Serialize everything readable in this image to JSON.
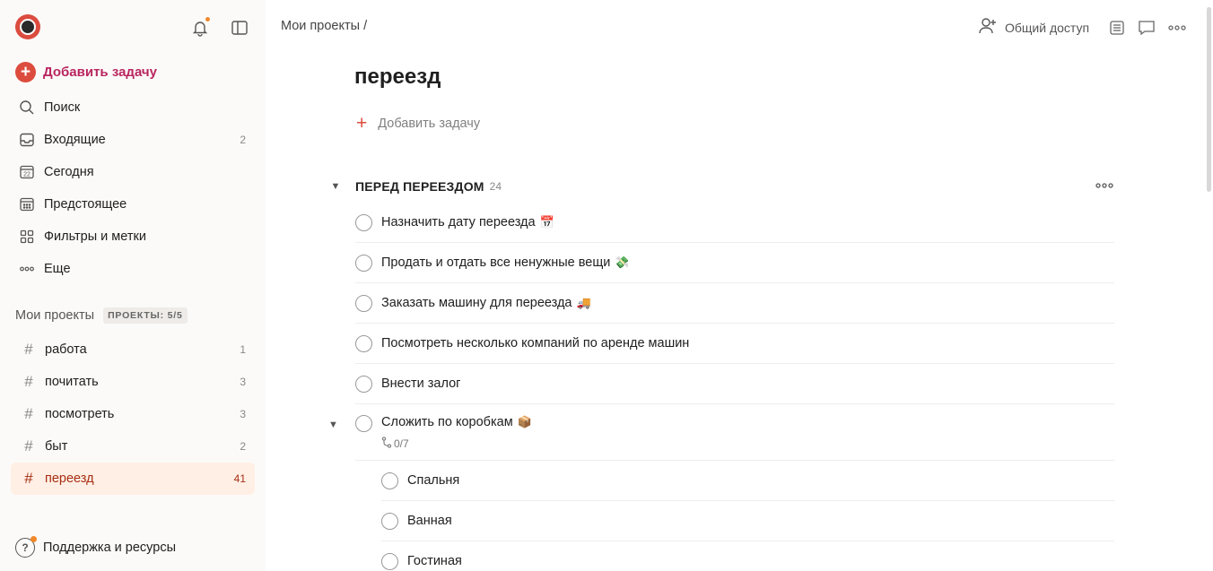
{
  "sidebar": {
    "add_task": "Добавить задачу",
    "nav": [
      {
        "label": "Поиск",
        "icon": "search-icon",
        "count": ""
      },
      {
        "label": "Входящие",
        "icon": "inbox-icon",
        "count": "2"
      },
      {
        "label": "Сегодня",
        "icon": "calendar-today-icon",
        "count": ""
      },
      {
        "label": "Предстоящее",
        "icon": "calendar-upcoming-icon",
        "count": ""
      },
      {
        "label": "Фильтры и метки",
        "icon": "filters-icon",
        "count": ""
      },
      {
        "label": "Еще",
        "icon": "more-icon",
        "count": ""
      }
    ],
    "projects_title": "Мои проекты",
    "projects_badge": "ПРОЕКТЫ: 5/5",
    "projects": [
      {
        "label": "работа",
        "count": "1"
      },
      {
        "label": "почитать",
        "count": "3"
      },
      {
        "label": "посмотреть",
        "count": "3"
      },
      {
        "label": "быт",
        "count": "2"
      },
      {
        "label": "переезд",
        "count": "41"
      }
    ],
    "support": "Поддержка и ресурсы"
  },
  "header": {
    "breadcrumb": "Мои проекты /",
    "share": "Общий доступ"
  },
  "main": {
    "title": "переезд",
    "add_task": "Добавить задачу",
    "section": {
      "name": "ПЕРЕД ПЕРЕЕЗДОМ",
      "count": "24"
    },
    "tasks": [
      {
        "text": "Назначить дату переезда",
        "emoji": "📅"
      },
      {
        "text": "Продать и отдать все ненужные вещи",
        "emoji": "💸"
      },
      {
        "text": "Заказать машину для переезда",
        "emoji": "🚚"
      },
      {
        "text": "Посмотреть несколько компаний по аренде машин",
        "emoji": ""
      },
      {
        "text": "Внести залог",
        "emoji": ""
      }
    ],
    "parent_task": {
      "text": "Сложить по коробкам",
      "emoji": "📦",
      "subtask_progress": "0/7"
    },
    "subtasks": [
      {
        "text": "Спальня"
      },
      {
        "text": "Ванная"
      },
      {
        "text": "Гостиная"
      }
    ]
  },
  "colors": {
    "accent": "#dc4c3e",
    "active_bg": "#ffefe5",
    "active_text": "#a82e12",
    "sidebar_bg": "#fcfaf8"
  }
}
